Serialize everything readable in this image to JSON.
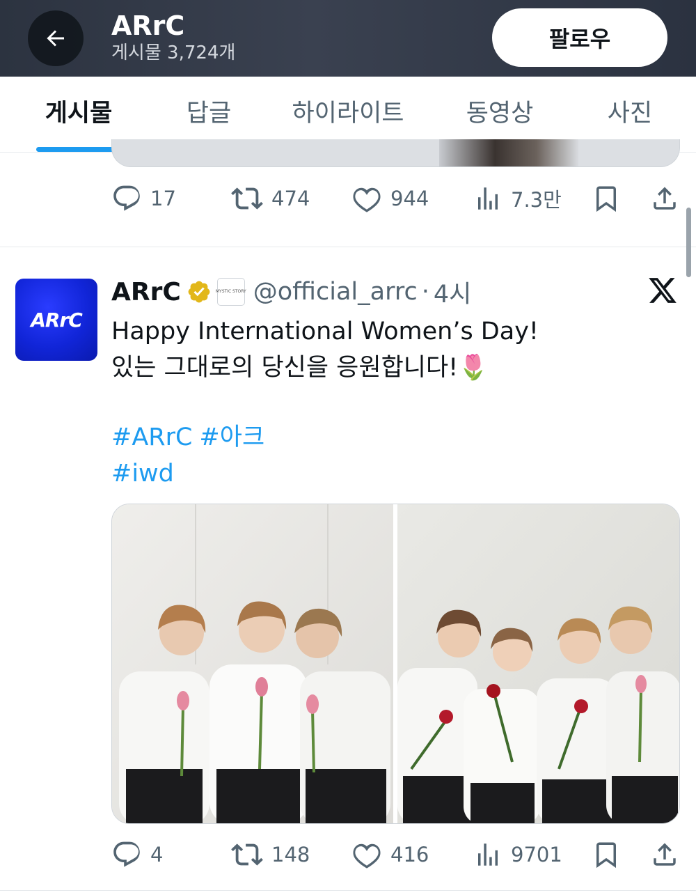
{
  "header": {
    "title": "ARrC",
    "post_count": "게시물 3,724개",
    "follow_label": "팔로우",
    "back_icon": "arrow-left-icon"
  },
  "tabs": [
    {
      "label": "게시물",
      "active": true
    },
    {
      "label": "답글",
      "active": false
    },
    {
      "label": "하이라이트",
      "active": false
    },
    {
      "label": "동영상",
      "active": false
    },
    {
      "label": "사진",
      "active": false
    }
  ],
  "previous_tweet": {
    "replies": "17",
    "reposts": "474",
    "likes": "944",
    "views": "7.3만"
  },
  "tweet": {
    "avatar_text": "ARrC",
    "display_name": "ARrC",
    "handle": "@official_arrc",
    "separator": "·",
    "time": "4시",
    "text_line_1": "Happy International Women’s Day!",
    "text_line_2": "있는 그대로의 당신을 응원합니다!🌷",
    "hashtags": [
      "#ARrC",
      "#아크",
      "#iwd"
    ],
    "replies": "4",
    "reposts": "148",
    "likes": "416",
    "views": "9701",
    "affiliate_badge": "MYSTIC STORY",
    "source_logo": "x-logo-icon"
  },
  "colors": {
    "accent": "#1d9bf0",
    "verified_gold": "#e2b719",
    "muted": "#536471",
    "avatar_blue": "#1125d8"
  }
}
